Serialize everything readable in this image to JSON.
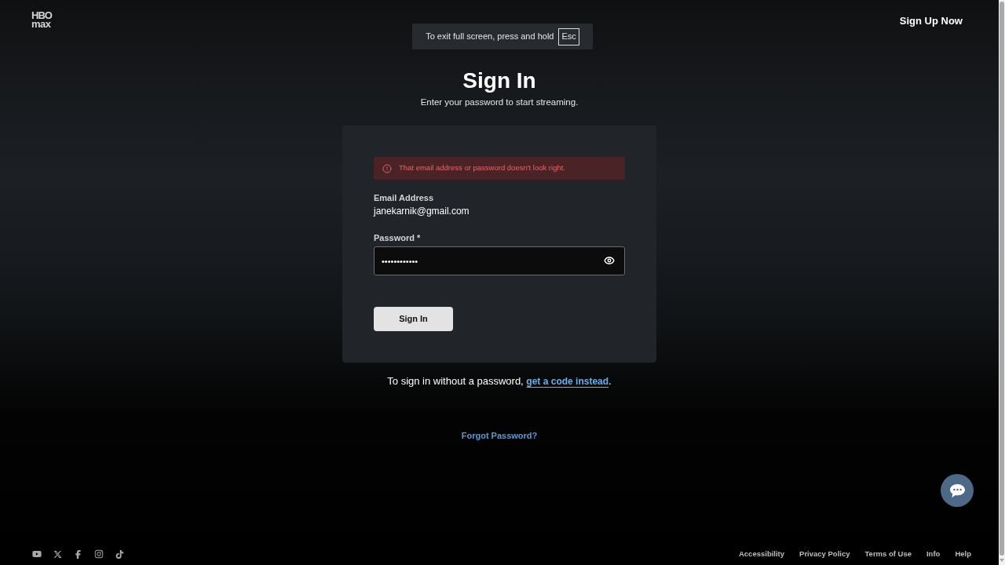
{
  "logo": {
    "line_1": "HBO",
    "line_2": "max"
  },
  "header": {
    "sign_up": "Sign Up Now"
  },
  "fullscreen_notice": {
    "text": "To exit full screen, press and hold",
    "key": "Esc"
  },
  "title": "Sign In",
  "subtitle": "Enter your password to start streaming.",
  "form": {
    "error": "That email address or password doesn't look right.",
    "email_label": "Email Address",
    "email_value": "janekarnik@gmail.com",
    "password_label": "Password *",
    "password_value": "••••••••••••",
    "submit": "Sign In"
  },
  "code_prompt": {
    "text": "To sign in without a password,",
    "link": "get a code instead",
    "end": "."
  },
  "forgot_password": "Forgot Password?",
  "footer": {
    "links": [
      "Accessibility",
      "Privacy Policy",
      "Terms of Use",
      "Info",
      "Help"
    ]
  }
}
